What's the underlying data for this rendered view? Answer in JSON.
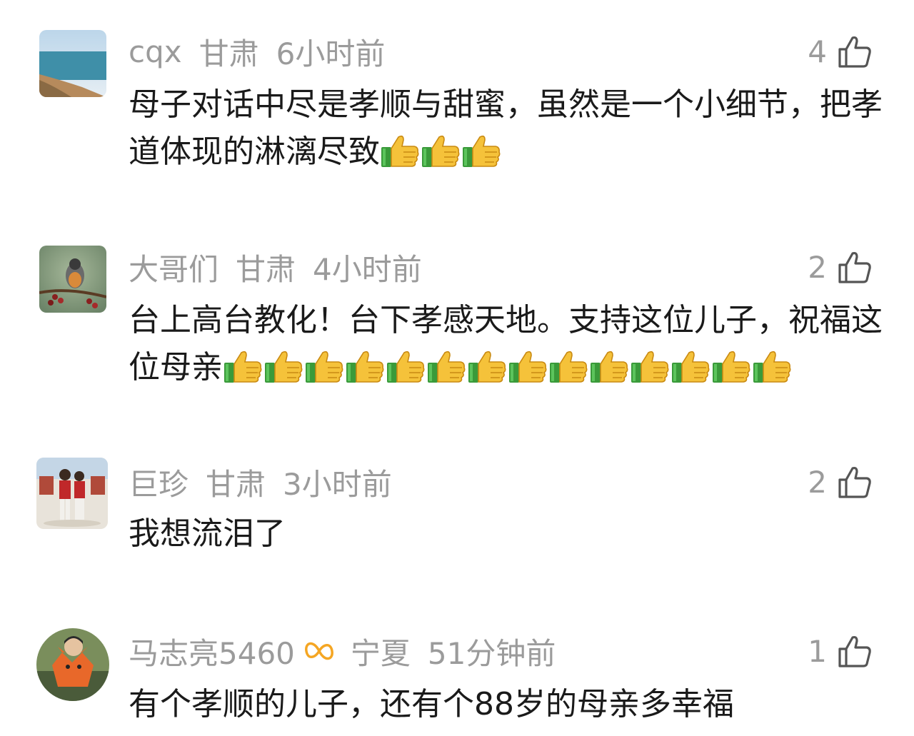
{
  "comments": [
    {
      "name": "cqx",
      "region": "甘肃",
      "time": "6小时前",
      "likes": "4",
      "text": "母子对话中尽是孝顺与甜蜜，虽然是一个小细节，把孝道体现的淋漓尽致",
      "emoji_count": 3,
      "avatar": "lake-landscape"
    },
    {
      "name": "大哥们",
      "region": "甘肃",
      "time": "4小时前",
      "likes": "2",
      "text": "台上高台教化！台下孝感天地。支持这位儿子，祝福这位母亲",
      "emoji_count": 14,
      "avatar": "bird-on-branch"
    },
    {
      "name": "巨珍",
      "region": "甘肃",
      "time": "3小时前",
      "likes": "2",
      "text": "我想流泪了",
      "emoji_count": 0,
      "avatar": "couple-festival"
    },
    {
      "name": "马志亮5460",
      "region": "宁夏",
      "time": "51分钟前",
      "likes": "1",
      "text": "有个孝顺的儿子，还有个88岁的母亲多幸福",
      "emoji_count": 0,
      "avatar": "child-fox-toy"
    }
  ],
  "icons": {
    "like": "thumbs-up-outline-icon",
    "emoji": "thumbs-up-emoji",
    "badge": "infinity-badge-icon"
  },
  "colors": {
    "meta": "#9b9b9b",
    "text": "#1a1a1a",
    "badge": "#f5a623"
  }
}
